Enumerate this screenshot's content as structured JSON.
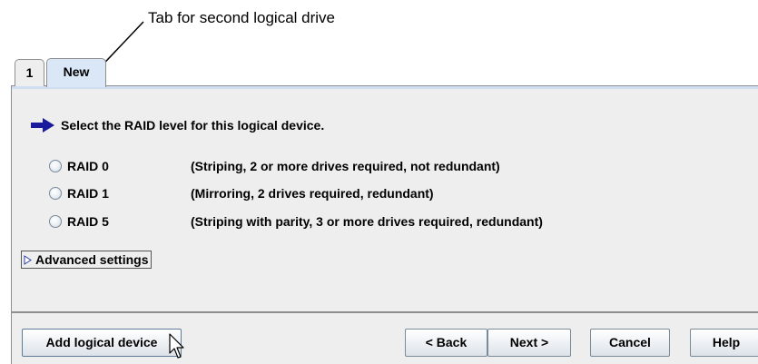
{
  "annotation": {
    "callout_text": "Tab for second logical drive"
  },
  "tabs": [
    {
      "label": "1",
      "selected": false
    },
    {
      "label": "New",
      "selected": true
    }
  ],
  "panel": {
    "instruction": "Select the RAID level for this logical device.",
    "raid_options": [
      {
        "label": "RAID 0",
        "description": "(Striping, 2 or more drives required, not redundant)",
        "selected": false
      },
      {
        "label": "RAID 1",
        "description": "(Mirroring, 2 drives required, redundant)",
        "selected": false
      },
      {
        "label": "RAID 5",
        "description": "(Striping with parity, 3 or more drives required, redundant)",
        "selected": false
      }
    ],
    "advanced_settings_label": "Advanced settings"
  },
  "buttons": {
    "add_logical_device": "Add logical device",
    "back": "< Back",
    "next": "Next >",
    "cancel": "Cancel",
    "help": "Help"
  },
  "colors": {
    "arrow": "#1a1a9c",
    "selected_tab": "#d9e7f7",
    "panel_bg": "#eeeeee"
  },
  "icons": {
    "instruction": "right-arrow-icon",
    "advanced": "expand-triangle-icon",
    "cursor": "mouse-pointer-icon"
  }
}
